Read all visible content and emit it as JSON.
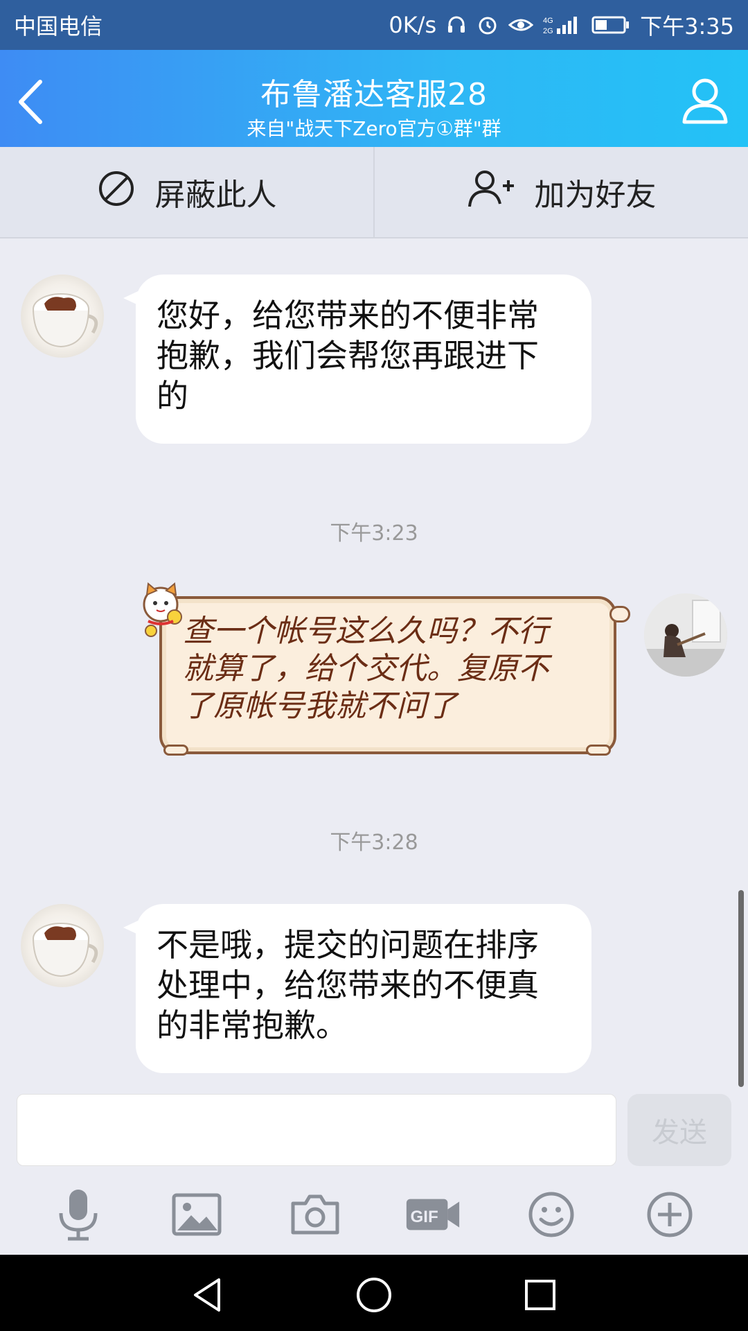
{
  "status_bar": {
    "carrier": "中国电信",
    "speed": "0K/s",
    "time": "下午3:35",
    "icons": [
      "headset-icon",
      "alarm-icon",
      "eye-icon",
      "signal-icon",
      "battery-icon"
    ]
  },
  "header": {
    "title": "布鲁潘达客服28",
    "subtitle": "来自\"战天下Zero官方①群\"群",
    "back_icon": "back-arrow-icon",
    "profile_icon": "profile-icon"
  },
  "actions": {
    "block_label": "屏蔽此人",
    "add_friend_label": "加为好友"
  },
  "messages": [
    {
      "sender": "service",
      "text_lines": [
        "您好，给您带来的不便非常",
        "抱歉，我们会帮您再跟进下",
        "的"
      ]
    },
    {
      "timestamp": "下午3:23"
    },
    {
      "sender": "me",
      "text_lines": [
        "查一个帐号这么久吗？不行",
        "就算了，给个交代。复原不",
        "了原帐号我就不问了"
      ]
    },
    {
      "timestamp": "下午3:28"
    },
    {
      "sender": "service",
      "text_lines": [
        "不是哦，提交的问题在排序",
        "处理中，给您带来的不便真",
        "的非常抱歉。"
      ]
    }
  ],
  "composer": {
    "input_value": "",
    "send_label": "发送"
  },
  "toolbar": [
    "microphone-icon",
    "image-icon",
    "camera-icon",
    "gif-icon",
    "emoji-icon",
    "plus-icon"
  ],
  "colors": {
    "status_bar": "#2f5f9e",
    "header_gradient_start": "#3e8cf4",
    "header_gradient_end": "#23c2f6",
    "chat_background": "#ebecf3",
    "scroll_text": "#6b2d15"
  }
}
